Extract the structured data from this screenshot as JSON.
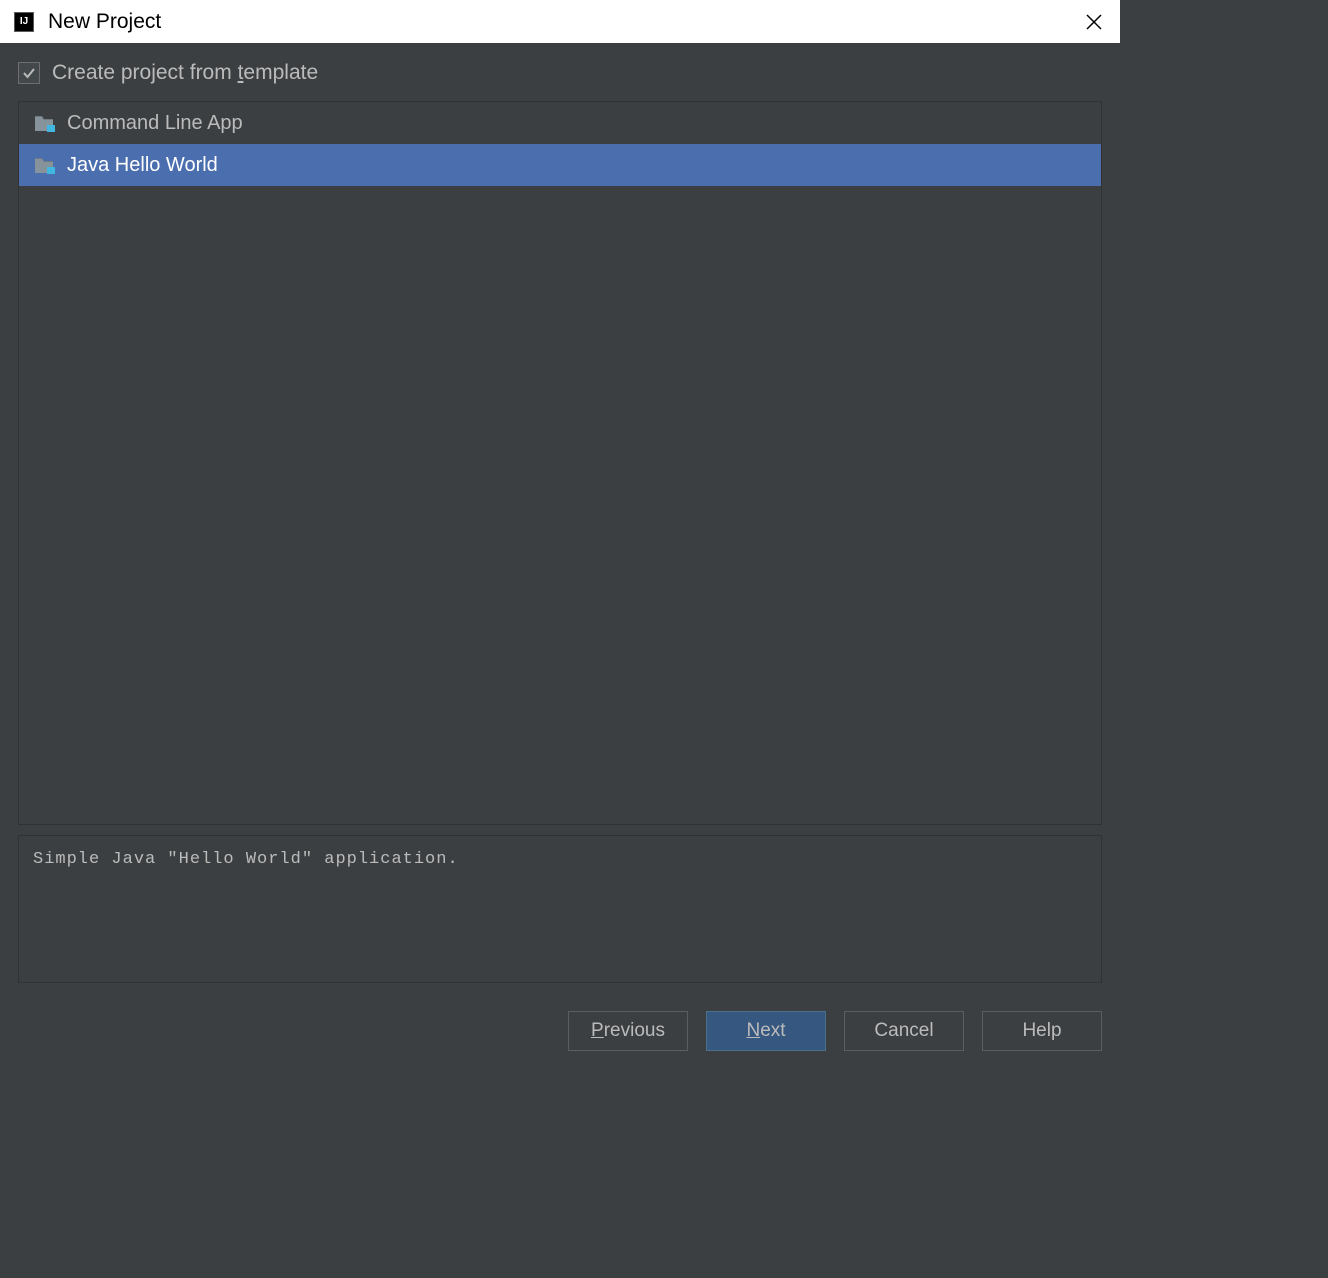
{
  "window": {
    "title": "New Project",
    "icon_label": "IJ"
  },
  "checkbox": {
    "checked": true,
    "label_prefix": "Create project from ",
    "label_underlined": "t",
    "label_suffix": "emplate"
  },
  "templates": [
    {
      "label": "Command Line App",
      "selected": false
    },
    {
      "label": "Java Hello World",
      "selected": true
    }
  ],
  "description": "Simple Java \"Hello World\" application.",
  "buttons": {
    "previous": {
      "underline": "P",
      "rest": "revious"
    },
    "next": {
      "underline": "N",
      "rest": "ext"
    },
    "cancel": "Cancel",
    "help": "Help"
  }
}
